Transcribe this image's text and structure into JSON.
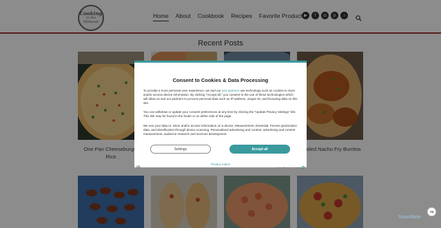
{
  "header": {
    "logo_text": [
      "Cooking",
      "in the",
      "Midwest"
    ],
    "nav": [
      {
        "label": "Home",
        "active": true
      },
      {
        "label": "About",
        "active": false
      },
      {
        "label": "Cookbook",
        "active": false
      },
      {
        "label": "Recipes",
        "active": false
      },
      {
        "label": "Favorite Products",
        "active": false
      }
    ],
    "social_icons": [
      "youtube-icon",
      "facebook-icon",
      "instagram-icon",
      "pinterest-icon",
      "tiktok-icon"
    ],
    "accent_color": "#9b3a3a"
  },
  "main": {
    "section_title": "Recent Posts",
    "posts": [
      {
        "title": "One Pan Cheeseburger Rice"
      },
      {
        "title": ""
      },
      {
        "title": ""
      },
      {
        "title": "Loaded Nacho Fry Burritos"
      }
    ]
  },
  "consent": {
    "title": "Consent to Cookies & Data Processing",
    "p1_before": "To provide a more personal user experience, we and our ",
    "p1_link": "315 partners",
    "p1_after": " use technology such as cookies to store and/or access device information. By clicking \"Accept all,\" you consent to the use of these technologies which will allow us and our partners to process personal data such as IP address, unique ID, and browsing data on this site.",
    "p2": "You can withdraw or update your consent preferences at any time by clicking the \"Update Privacy Settings\" link. This link may be found in the footer or on either side of the page.",
    "p3": "We use your data to: Store and/or access information on a device, Measurement, Essential, Precise geolocation data, and identification through device scanning, Personalised advertising and content, advertising and content measurement, audience research and services development",
    "settings_label": "Settings",
    "accept_label": "Accept all",
    "privacy_label": "Privacy notice",
    "flag_label": "US",
    "powered_label": "Cookie Banner powered by",
    "accent_color": "#3a9a9e"
  },
  "corner_badge": "TM",
  "watermark": "ScanMate"
}
